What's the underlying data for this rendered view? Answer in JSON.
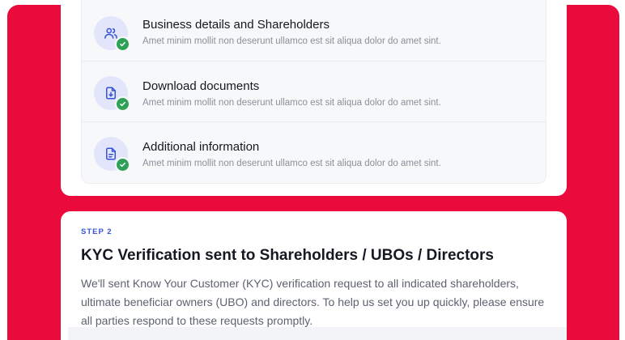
{
  "checklist": {
    "items": [
      {
        "title": "Business details and Shareholders",
        "description": "Amet minim mollit non deserunt ullamco est sit aliqua dolor do amet sint.",
        "icon": "users-icon",
        "status": "complete"
      },
      {
        "title": "Download documents",
        "description": "Amet minim mollit non deserunt ullamco est sit aliqua dolor do amet sint.",
        "icon": "download-document-icon",
        "status": "complete"
      },
      {
        "title": "Additional  information",
        "description": "Amet minim mollit non deserunt ullamco est sit aliqua dolor do amet sint.",
        "icon": "document-text-icon",
        "status": "complete"
      }
    ]
  },
  "step": {
    "label": "STEP 2",
    "title": "KYC Verification sent to Shareholders / UBOs / Directors",
    "description": "We'll sent Know Your Customer (KYC) verification request to all indicated shareholders, ultimate beneficiar owners (UBO) and directors. To help us set you up quickly, please ensure all parties respond to these requests promptly."
  },
  "colors": {
    "brand_red": "#eb0a3c",
    "accent_blue": "#3553d6",
    "success_green": "#2fa157",
    "icon_bg": "#e3e6fb"
  }
}
